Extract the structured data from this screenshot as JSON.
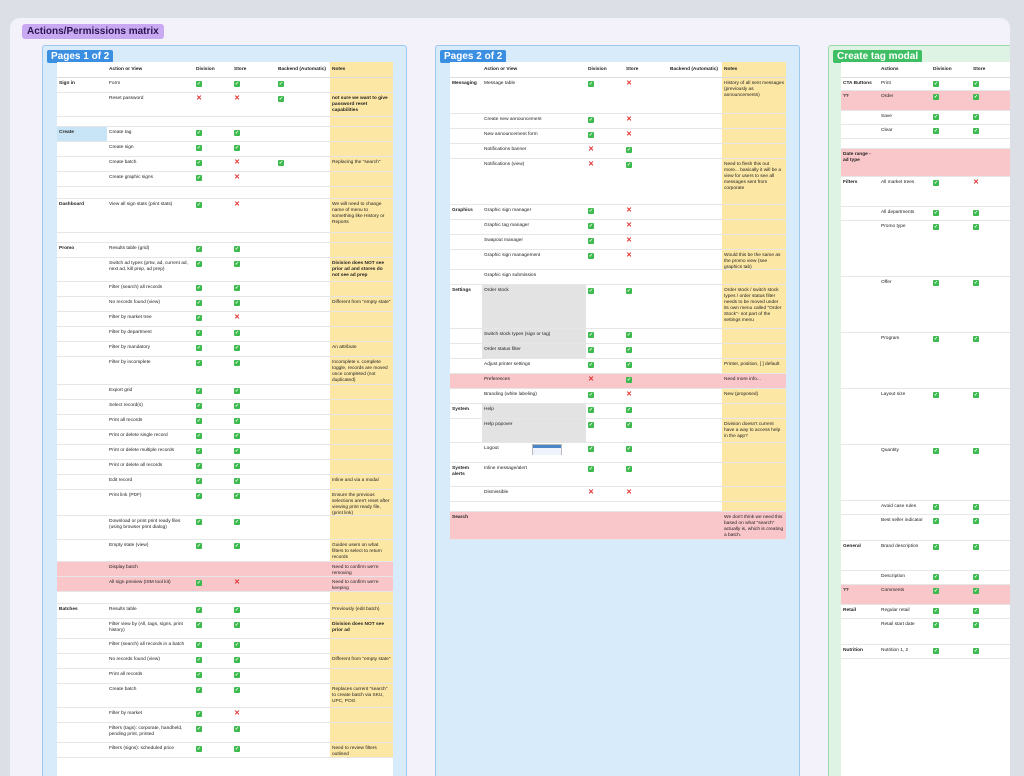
{
  "board_title": "Actions/Permissions matrix",
  "frames": [
    {
      "badge": "Pages 1 of 2",
      "headers": [
        "",
        "Action or View",
        "Division",
        "Store",
        "Backend (Automatic)",
        "Notes"
      ],
      "rows": [
        {
          "section": "Sign in",
          "action": "Form",
          "division": "ok",
          "store": "ok",
          "backend": "ok",
          "notes": "",
          "h": 15
        },
        {
          "action": "Reset password",
          "division": "no",
          "store": "no",
          "backend": "ok",
          "notes": "not sure we want to give password reset capabilities",
          "h": 24
        },
        {
          "h": 10
        },
        {
          "section": "Create",
          "section_hl": true,
          "action": "Create tag",
          "division": "ok",
          "store": "ok",
          "notes": "",
          "h": 15
        },
        {
          "action": "Create sign",
          "division": "ok",
          "store": "ok",
          "notes": "",
          "h": 15
        },
        {
          "action": "Create batch",
          "division": "ok",
          "store": "no",
          "backend": "ok",
          "notes": "Replacing the \"search\"",
          "h": 15
        },
        {
          "action": "Create graphic signs",
          "division": "ok",
          "store": "no",
          "notes": "",
          "h": 15
        },
        {
          "h": 12
        },
        {
          "section": "Dashboard",
          "action": "View all sign stats (print stats)",
          "division": "ok",
          "store": "no",
          "notes": "We will need to change name of menu to something like History or Reports",
          "h": 34
        },
        {
          "h": 10
        },
        {
          "section": "Promo",
          "action": "Results table (grid)",
          "division": "ok",
          "store": "ok",
          "notes": "",
          "h": 15
        },
        {
          "action": "Switch ad types (prtw, ad, current ad, next ad, kill prep, ad prep)",
          "division": "ok",
          "store": "ok",
          "notes": "Division does NOT see prior ad and stores do not see ad prep",
          "h": 24
        },
        {
          "action": "Filter (search) all records",
          "division": "ok",
          "store": "ok",
          "notes": "",
          "h": 15
        },
        {
          "action": "No records found (view)",
          "division": "ok",
          "store": "ok",
          "notes": "Different from \"empty state\"",
          "h": 15
        },
        {
          "action": "Filter by market tree",
          "division": "ok",
          "store": "no",
          "notes": "",
          "h": 15
        },
        {
          "action": "Filter by department",
          "division": "ok",
          "store": "ok",
          "notes": "",
          "h": 15
        },
        {
          "action": "Filter by mandatory",
          "division": "ok",
          "store": "ok",
          "notes": "An attribute",
          "h": 15
        },
        {
          "action": "Filter by incomplete",
          "division": "ok",
          "store": "ok",
          "notes": "Incomplete v. complete toggle, records are moved once completed (not duplicated)",
          "h": 28
        },
        {
          "action": "Export grid",
          "division": "ok",
          "store": "ok",
          "notes": "",
          "h": 15
        },
        {
          "action": "Select record(s)",
          "division": "ok",
          "store": "ok",
          "notes": "",
          "h": 15
        },
        {
          "action": "Print all records",
          "division": "ok",
          "store": "ok",
          "notes": "",
          "h": 15
        },
        {
          "action": "Print or delete single record",
          "division": "ok",
          "store": "ok",
          "notes": "",
          "h": 15
        },
        {
          "action": "Print or delete multiple records",
          "division": "ok",
          "store": "ok",
          "notes": "",
          "h": 15
        },
        {
          "action": "Print or delete all records",
          "division": "ok",
          "store": "ok",
          "notes": "",
          "h": 15
        },
        {
          "action": "Edit record",
          "division": "ok",
          "store": "ok",
          "notes": "Inline and via a modal",
          "h": 15
        },
        {
          "action": "Print link (PDF)",
          "division": "ok",
          "store": "ok",
          "notes": "Ensure the previous selections aren't reset after viewing print ready file, (print link)",
          "h": 26
        },
        {
          "action": "Download or print print ready files (using browser print dialog)",
          "division": "ok",
          "store": "ok",
          "notes": "",
          "h": 24
        },
        {
          "action": "Empty state (view)",
          "division": "ok",
          "store": "ok",
          "notes": "Guides users on what filters to select to return records",
          "h": 22
        },
        {
          "pink": true,
          "action": "Display batch",
          "notes": "Need to confirm we're removing",
          "h": 15
        },
        {
          "pink": true,
          "action": "All sign preview (ISM tool kit)",
          "division": "ok",
          "store": "no",
          "notes": "Need to confirm we're keeping",
          "h": 15
        },
        {
          "h": 12
        },
        {
          "section": "Batches",
          "action": "Results table",
          "division": "ok",
          "store": "ok",
          "notes": "Previously (edit batch)",
          "h": 15
        },
        {
          "action": "Filter view by (All, tags, signs, print history)",
          "division": "ok",
          "store": "ok",
          "notes": "Division does NOT see prior ad",
          "h": 20
        },
        {
          "action": "Filter (search) all records in a batch",
          "division": "ok",
          "store": "ok",
          "notes": "",
          "h": 15
        },
        {
          "action": "No records found (view)",
          "division": "ok",
          "store": "ok",
          "notes": "Different from \"empty state\"",
          "h": 15
        },
        {
          "action": "Print all records",
          "division": "ok",
          "store": "ok",
          "notes": "",
          "h": 15
        },
        {
          "action": "Create batch",
          "division": "ok",
          "store": "ok",
          "notes": "Replaces current \"search\" to create batch via SKU, UPC, POG",
          "h": 24
        },
        {
          "action": "Filter by market",
          "division": "ok",
          "store": "no",
          "notes": "",
          "h": 15
        },
        {
          "action": "Filters (tags): corporate, handheld, pending print, printed",
          "division": "ok",
          "store": "ok",
          "notes": "",
          "h": 20
        },
        {
          "action": "Filters (signs): scheduled price",
          "division": "ok",
          "store": "ok",
          "notes": "Need to review filters outlined",
          "h": 15
        }
      ]
    },
    {
      "badge": "Pages 2 of 2",
      "headers": [
        "",
        "Action or View",
        "Division",
        "Store",
        "Backend (Automatic)",
        "Notes"
      ],
      "rows": [
        {
          "section": "Messaging",
          "action": "Message table",
          "division": "ok",
          "store": "no",
          "notes": "History of all sent messages (previously as announcements)",
          "h": 36
        },
        {
          "action": "Create new announcement",
          "division": "ok",
          "store": "no",
          "notes": "",
          "h": 15
        },
        {
          "action": "New announcement form",
          "division": "ok",
          "store": "no",
          "notes": "",
          "h": 15
        },
        {
          "action": "Notifications banner",
          "division": "no",
          "store": "ok",
          "notes": "",
          "h": 15
        },
        {
          "action": "Notifications (view)",
          "division": "no",
          "store": "ok",
          "notes": "Need to flesh this out more... basically it will be a view for users to see all messages sent from corporate",
          "h": 46
        },
        {
          "section": "Graphics",
          "action": "Graphic sign manager",
          "division": "ok",
          "store": "no",
          "notes": "",
          "h": 15
        },
        {
          "action": "Graphic tag manager",
          "division": "ok",
          "store": "no",
          "notes": "",
          "h": 15
        },
        {
          "action": "Swapout manager",
          "division": "ok",
          "store": "no",
          "notes": "",
          "h": 15
        },
        {
          "action": "Graphic sign management",
          "division": "ok",
          "store": "no",
          "notes": "Would this be the same as the promo view (see graphics tab)",
          "h": 20
        },
        {
          "action": "Graphic sign submission",
          "notes": "",
          "h": 15
        },
        {
          "section": "Settings",
          "action": "Order stock",
          "shade": true,
          "division": "ok",
          "store": "ok",
          "notes": "Order stock / switch stock types / order status filter needs to be moved under its own menu called \"Order Stock\"- not part of the settings menu",
          "h": 44
        },
        {
          "action": "Switch stock types (sign or tag)",
          "shade": true,
          "division": "ok",
          "store": "ok",
          "notes": "",
          "h": 15
        },
        {
          "action": "Order status filter",
          "shade": true,
          "division": "ok",
          "store": "ok",
          "notes": "",
          "h": 15
        },
        {
          "action": "Adjust printer settings",
          "division": "ok",
          "store": "ok",
          "notes": "Printer, position, [ ] default",
          "h": 15
        },
        {
          "pink": true,
          "action": "Preferences",
          "division": "no",
          "store": "ok",
          "notes": "Need more info...",
          "h": 15
        },
        {
          "action": "Branding (white labeling)",
          "division": "ok",
          "store": "no",
          "notes": "New (proposed)",
          "h": 15
        },
        {
          "section": "System",
          "action": "Help",
          "shade": true,
          "division": "ok",
          "store": "ok",
          "notes": "",
          "h": 15
        },
        {
          "action": "Help popover",
          "shade": true,
          "division": "ok",
          "store": "ok",
          "notes": "Division doesn't current have a way to access help in the app?",
          "h": 24
        },
        {
          "action": "Logout",
          "thumb": true,
          "division": "ok",
          "store": "ok",
          "notes": "",
          "h": 20
        },
        {
          "section": "System alerts",
          "action": "Inline message/alert",
          "division": "ok",
          "store": "ok",
          "notes": "",
          "h": 24
        },
        {
          "action": "Dismissible",
          "division": "no",
          "store": "no",
          "notes": "",
          "h": 15
        },
        {
          "h": 10
        },
        {
          "pink": true,
          "section": "Search",
          "notes": "We don't think we need this based on what \"search\" actually is, which is creating a batch.",
          "h": 28
        }
      ]
    },
    {
      "badge": "Create tag modal",
      "headers": [
        "",
        "Actions",
        "Division",
        "Store"
      ],
      "rows": [
        {
          "section": "CTA Buttons",
          "action": "Print",
          "division": "ok",
          "store": "ok",
          "h": 13
        },
        {
          "pink": true,
          "section": "??",
          "action": "Order",
          "division": "ok",
          "store": "ok",
          "h": 20
        },
        {
          "action": "Save",
          "division": "ok",
          "store": "ok",
          "h": 14
        },
        {
          "action": "Clear",
          "division": "ok",
          "store": "ok",
          "h": 14
        },
        {
          "h": 10
        },
        {
          "pink": true,
          "section": "Date range - ad type",
          "h": 28
        },
        {
          "section": "Filters",
          "action": "All market trees",
          "division": "ok",
          "store": "no",
          "h": 30
        },
        {
          "action": "All departments",
          "division": "ok",
          "store": "ok",
          "h": 14
        },
        {
          "action": "Promo type",
          "division": "ok",
          "store": "ok",
          "h": 56
        },
        {
          "action": "Offer",
          "division": "ok",
          "store": "ok",
          "h": 56
        },
        {
          "action": "Program",
          "division": "ok",
          "store": "ok",
          "h": 56
        },
        {
          "action": "Layout size",
          "division": "ok",
          "store": "ok",
          "h": 56
        },
        {
          "action": "Quantity",
          "division": "ok",
          "store": "ok",
          "h": 56
        },
        {
          "action": "Avoid case rules",
          "division": "ok",
          "store": "ok",
          "h": 14
        },
        {
          "action": "Best seller indicator",
          "division": "ok",
          "store": "ok",
          "h": 26
        },
        {
          "section": "General",
          "action": "Brand description",
          "division": "ok",
          "store": "ok",
          "h": 30
        },
        {
          "action": "Description",
          "division": "ok",
          "store": "ok",
          "h": 14
        },
        {
          "pink": true,
          "section": "??",
          "action": "Comments",
          "division": "ok",
          "store": "ok",
          "h": 20
        },
        {
          "section": "Retail",
          "action": "Regular retail",
          "division": "ok",
          "store": "ok",
          "h": 14
        },
        {
          "action": "Retail start date",
          "division": "ok",
          "store": "ok",
          "h": 26
        },
        {
          "section": "Nutrition",
          "action": "Nutrition 1, 2",
          "division": "ok",
          "store": "ok",
          "h": 14
        }
      ]
    }
  ],
  "colors": {
    "ok": "#3dba4e",
    "no": "#e02b2b",
    "notes": "#fde7a5",
    "pink": "#f9c6c9",
    "frame_blue": "#d8ebfa",
    "frame_green": "#dff3e4"
  },
  "icons": {
    "ok": "check-icon",
    "no": "x-icon"
  }
}
